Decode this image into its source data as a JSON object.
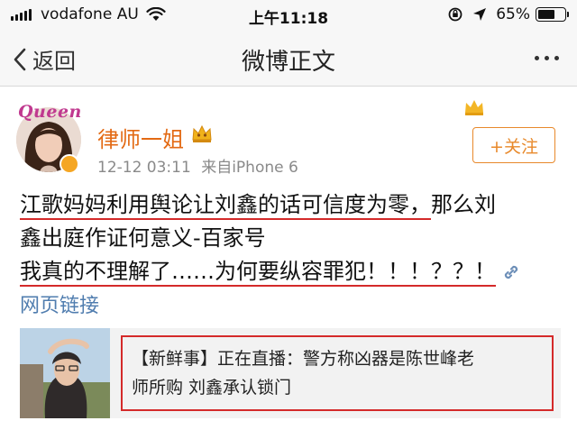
{
  "status_bar": {
    "carrier": "vodafone AU",
    "time": "上午11:18",
    "battery": "65%",
    "battery_level": 0.65
  },
  "nav": {
    "back_label": "返回",
    "title": "微博正文"
  },
  "post": {
    "avatar_text": "Queen",
    "username": "律师一姐",
    "date": "12-12 03:11",
    "source": "来自iPhone 6",
    "follow_label": "+关注",
    "lines": [
      "江歌妈妈利用舆论让刘鑫的话可信度为零，",
      "那么刘",
      "鑫出庭作证何意义-百家号",
      "我真的不理解了……为何要纵容罪犯！！！？？！"
    ],
    "web_link": "网页链接"
  },
  "card": {
    "line1": "【新鲜事】正在直播：警方称凶器是陈世峰老",
    "line2": "师所购 刘鑫承认锁门"
  },
  "colors": {
    "username": "#e36a14",
    "follow": "#e8892b",
    "link": "#507daf",
    "highlight": "#d42a2a"
  }
}
